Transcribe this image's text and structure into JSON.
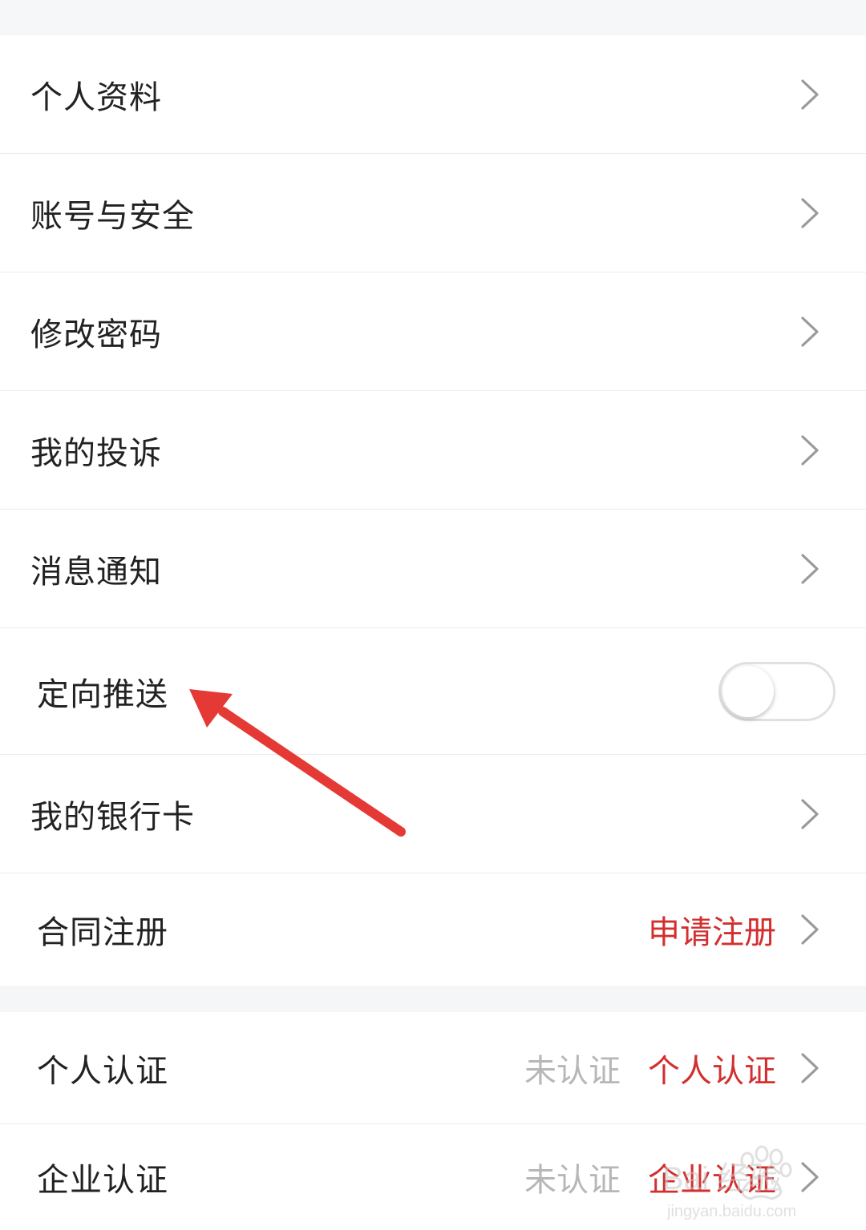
{
  "colors": {
    "accent_red": "#d32f2f",
    "status_gray": "#b7b7b7",
    "label_dark": "#222222",
    "arrow_red": "#e53935"
  },
  "settings": [
    {
      "label": "个人资料"
    },
    {
      "label": "账号与安全"
    },
    {
      "label": "修改密码"
    },
    {
      "label": "我的投诉"
    },
    {
      "label": "消息通知"
    },
    {
      "label": "定向推送",
      "toggle_on": false
    },
    {
      "label": "我的银行卡"
    },
    {
      "label": "合同注册",
      "action": "申请注册"
    }
  ],
  "certifications": [
    {
      "label": "个人认证",
      "status": "未认证",
      "action": "个人认证"
    },
    {
      "label": "企业认证",
      "status": "未认证",
      "action": "企业认证"
    }
  ],
  "watermark": {
    "brand": "Bai 经验",
    "url": "jingyan.baidu.com"
  }
}
